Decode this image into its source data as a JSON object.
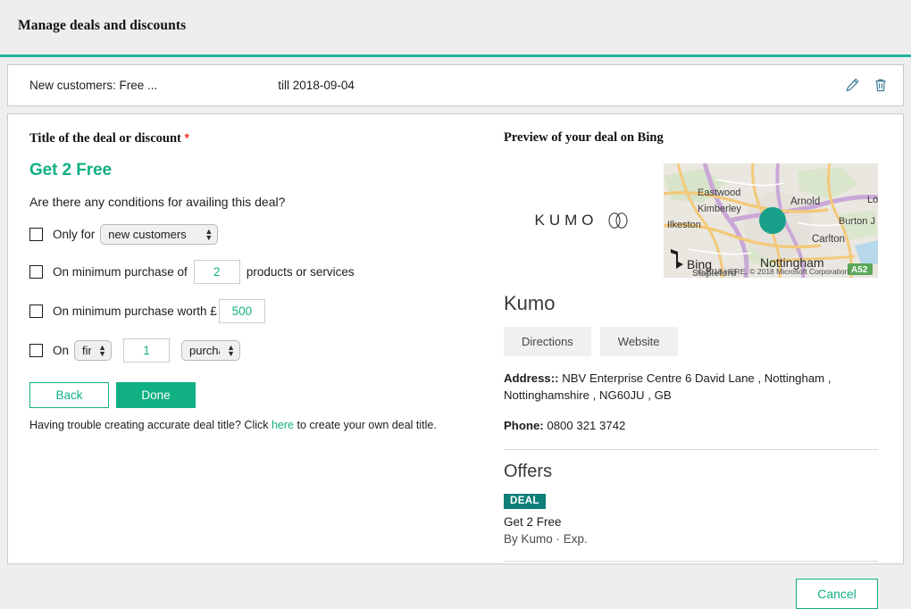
{
  "header": {
    "title": "Manage deals and discounts",
    "accent_color": "#23b39a"
  },
  "deal_summary": {
    "title": "New customers: Free ...",
    "expiry": "till 2018-09-04",
    "edit_icon": "pencil-icon",
    "delete_icon": "trash-icon",
    "icon_color": "#3a7c95"
  },
  "form": {
    "title_label": "Title of the deal or discount",
    "required_mark": "*",
    "deal_title_value": "Get 2 Free",
    "question": "Are there any conditions for availing this deal?",
    "conditions": [
      {
        "prefix": "Only for",
        "select_value": "new customers",
        "suffix": ""
      },
      {
        "prefix": "On minimum purchase of",
        "input_value": "2",
        "suffix": "products or services"
      },
      {
        "prefix": "On minimum purchase worth £",
        "input_value": "500",
        "suffix": ""
      },
      {
        "prefix": "On",
        "select_value": "first",
        "input_value": "1",
        "select2_value": "purchase"
      }
    ],
    "back_label": "Back",
    "done_label": "Done",
    "help_before": "Having trouble creating accurate deal title? Click ",
    "help_link": "here",
    "help_after": " to create your own deal title.",
    "accent_color": "#11b083"
  },
  "preview": {
    "heading": "Preview of your deal on Bing",
    "logo_text": "KUMO",
    "map": {
      "labels": [
        "Eastwood",
        "Kimberley",
        "Ilkeston",
        "Arnold",
        "Carlton",
        "Burton J",
        "Lo",
        "Nottingham",
        "Stapleford"
      ],
      "road_badge": "A52",
      "provider": "Bing",
      "attribution": "© 2018 HERE, © 2018 Microsoft Corporation",
      "pin_color": "#18a08a"
    },
    "business_name": "Kumo",
    "directions_label": "Directions",
    "website_label": "Website",
    "address_label": "Address::",
    "address_value": "NBV Enterprise Centre 6 David Lane , Nottingham , Nottinghamshire , NG60JU , GB",
    "phone_label": "Phone:",
    "phone_value": "0800 321 3742",
    "offers_heading": "Offers",
    "deal_badge": "DEAL",
    "offer_title": "Get 2 Free",
    "offer_sub": "By Kumo · Exp.",
    "cancel_label": "Cancel"
  }
}
